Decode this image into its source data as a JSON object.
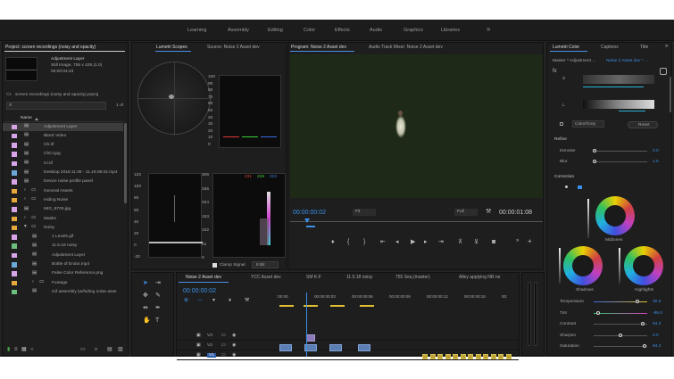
{
  "workspaces": [
    "Learning",
    "Assembly",
    "Editing",
    "Color",
    "Effects",
    "Audio",
    "Graphics",
    "Libraries"
  ],
  "overflow_glyph": "»",
  "project": {
    "tab": "Project: screen recordings (noisy and opacity)",
    "preview_title": "Adjustment Layer",
    "preview_info1": "Still Image, 755 x 425 (1.0)",
    "preview_info2": "00:00:04:23",
    "project_file": "screen recordings (noisy and opacity).prproj",
    "page_count": "1 of",
    "col_name": "Name",
    "items": [
      {
        "name": "Adjustment Layer",
        "color": "#d7a4e8",
        "indent": 0,
        "folder": false,
        "selected": true
      },
      {
        "name": "Black Video",
        "color": "#d7a4e8",
        "indent": 0,
        "folder": false
      },
      {
        "name": "Cb.tif",
        "color": "#d7a4e8",
        "indent": 0,
        "folder": false
      },
      {
        "name": "CbCr.jpg",
        "color": "#d7a4e8",
        "indent": 0,
        "folder": false
      },
      {
        "name": "Cr.tif",
        "color": "#d7a4e8",
        "indent": 0,
        "folder": false
      },
      {
        "name": "Desktop 2018.11.06 - 11.19.08.02.mp4",
        "color": "#6aa9d8",
        "indent": 0,
        "folder": false
      },
      {
        "name": "Device noise profile panel",
        "color": "#d7a4e8",
        "indent": 0,
        "folder": false
      },
      {
        "name": "General Assets",
        "color": "#e6a83c",
        "indent": 0,
        "folder": true
      },
      {
        "name": "Hiding Noise",
        "color": "#e6a83c",
        "indent": 0,
        "folder": true
      },
      {
        "name": "IMG_8700.jpg",
        "color": "#d7a4e8",
        "indent": 0,
        "folder": false
      },
      {
        "name": "Masks",
        "color": "#e6a83c",
        "indent": 0,
        "folder": true
      },
      {
        "name": "Noisy",
        "color": "#e6a83c",
        "indent": 0,
        "folder": true,
        "open": true
      },
      {
        "name": "1 Levels.gif",
        "color": "#d7a4e8",
        "indent": 1,
        "folder": false
      },
      {
        "name": "11.5.18 noisy",
        "color": "#6bbf7a",
        "indent": 1,
        "folder": false
      },
      {
        "name": "Adjustment Layer",
        "color": "#d7a4e8",
        "indent": 1,
        "folder": false
      },
      {
        "name": "Bottle of Endor.mp4",
        "color": "#6aa9d8",
        "indent": 1,
        "folder": false
      },
      {
        "name": "False Color Reference.png",
        "color": "#d7a4e8",
        "indent": 1,
        "folder": false
      },
      {
        "name": "Footage",
        "color": "#e6a83c",
        "indent": 1,
        "folder": true
      },
      {
        "name": "Gif assembly (w/hiding noise asse",
        "color": "#6bbf7a",
        "indent": 1,
        "folder": false
      }
    ]
  },
  "scopes": {
    "tab_lumetri": "Lumetri Scopes",
    "tab_source": "Source: Noise 2 Asset dev",
    "parade_labels": [
      "100",
      "90",
      "80",
      "70",
      "60",
      "50",
      "40",
      "30",
      "20",
      "10",
      "0"
    ],
    "wave_labels_left": [
      "120",
      "100",
      "80",
      "60",
      "40",
      "20",
      "0",
      "-20"
    ],
    "wave_labels_right": [
      "306",
      "255",
      "204",
      "153",
      "102",
      "51",
      "0"
    ],
    "rgb_readout": [
      "231",
      "228",
      "223"
    ],
    "clamp_label": "Clamp Signal",
    "bit_depth": "8 Bit"
  },
  "program": {
    "tab": "Program: Noise 2 Asset dev",
    "tab2": "Audio Track Mixer: Noise 2 Asset dev",
    "timecode": "00:00:00:02",
    "fit": "Fit",
    "quality": "Full",
    "duration": "00:00:01:08"
  },
  "lumetri": {
    "tab": "Lumetri Color",
    "tab2": "Captions",
    "tab3": "Title",
    "master": "Master * Adjustment ...",
    "clip": "Noise 2 Asset dev * ...",
    "s_label": "S",
    "l_label": "L",
    "color_grey": "Color/Grey",
    "reset": "Reset",
    "refine": "Refine",
    "denoise": "Denoise",
    "denoise_val": "0.0",
    "blur": "Blur",
    "blur_val": "1.5",
    "correction": "Correction",
    "midtones": "Midtones",
    "shadows": "Shadows",
    "highlights": "Highlights",
    "params": [
      {
        "name": "Temperature",
        "value": "30.3",
        "pos": 0.82
      },
      {
        "name": "Tint",
        "value": "-88.0",
        "pos": 0.08
      },
      {
        "name": "Contrast",
        "value": "84.3",
        "pos": 0.92
      },
      {
        "name": "Sharpen",
        "value": "0.0",
        "pos": 0.5
      },
      {
        "name": "Saturation",
        "value": "94.4",
        "pos": 0.95
      }
    ]
  },
  "timeline": {
    "tabs": [
      "Noise 2 Asset dev",
      "YCC Asset dev",
      "SM K-F",
      "11.5.18 noisy",
      "755 Seq (master)",
      "Alley applying NR ne"
    ],
    "timecode": "00:00:00:02",
    "ruler": [
      ":00:00",
      "00:00:00:03",
      "00:00:00:06",
      "00:00:00:09",
      "00:00:00:12",
      "00:00:00:15",
      "00:"
    ],
    "tracks": [
      "V3",
      "V2",
      "V1"
    ]
  }
}
